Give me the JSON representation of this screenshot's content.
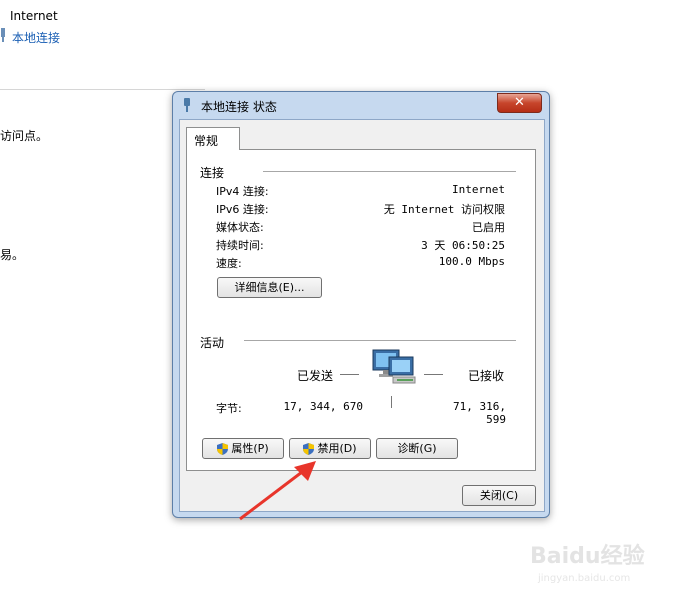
{
  "background": {
    "title": "Internet",
    "link": "本地连接",
    "text1": "访问点。",
    "text2": "易。"
  },
  "dialog": {
    "title": "本地连接 状态",
    "close": "✕",
    "tab": "常规",
    "connection": {
      "heading": "连接",
      "rows": [
        {
          "label": "IPv4 连接:",
          "value": "Internet"
        },
        {
          "label": "IPv6 连接:",
          "value": "无 Internet 访问权限"
        },
        {
          "label": "媒体状态:",
          "value": "已启用"
        },
        {
          "label": "持续时间:",
          "value": "3 天 06:50:25"
        },
        {
          "label": "速度:",
          "value": "100.0 Mbps"
        }
      ],
      "details_button": "详细信息(E)..."
    },
    "activity": {
      "heading": "活动",
      "sent_label": "已发送",
      "received_label": "已接收",
      "bytes_label": "字节:",
      "bytes_sent": "17, 344, 670",
      "bytes_received": "71, 316, 599"
    },
    "buttons": {
      "properties": "属性(P)",
      "disable": "禁用(D)",
      "diagnose": "诊断(G)",
      "close": "关闭(C)"
    }
  },
  "watermark": {
    "brand": "Baidu经验",
    "url": "jingyan.baidu.com"
  },
  "colors": {
    "link": "#1a5fb4",
    "arrow": "#e8352b",
    "dialog_frame": "#c6d9ef"
  }
}
